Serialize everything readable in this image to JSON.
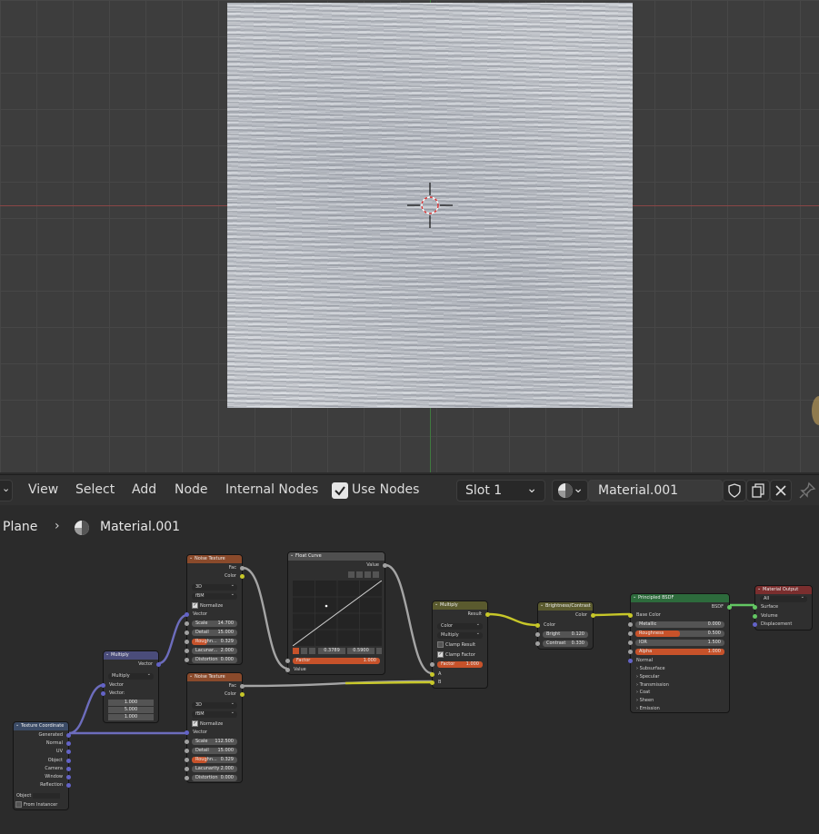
{
  "header": {
    "menu": [
      "View",
      "Select",
      "Add",
      "Node",
      "Internal Nodes"
    ],
    "use_nodes_label": "Use Nodes",
    "slot": "Slot 1",
    "material": "Material.001"
  },
  "breadcrumb": {
    "object": "Plane",
    "material": "Material.001"
  },
  "nodes": {
    "texcoord": {
      "title": "Texture Coordinate",
      "outputs": [
        "Generated",
        "Normal",
        "UV",
        "Object",
        "Camera",
        "Window",
        "Reflection"
      ],
      "object_label": "Object",
      "from_instancer": "From Instancer"
    },
    "vmultiply": {
      "title": "Multiply",
      "out": "Vector",
      "mode": "Multiply",
      "in1": "Vector",
      "in2": "Vector:",
      "v": [
        "1.000",
        "5.000",
        "1.000"
      ]
    },
    "noise1": {
      "title": "Noise Texture",
      "outs": [
        "Fac",
        "Color"
      ],
      "dim": "3D",
      "type": "fBM",
      "normalize": "Normalize",
      "vector": "Vector",
      "fields": [
        [
          "Scale",
          "14.700"
        ],
        [
          "Detail",
          "15.000"
        ],
        [
          "Roughn...",
          "0.329"
        ],
        [
          "Lacunar...",
          "2.000"
        ],
        [
          "Distortion",
          "0.000"
        ]
      ]
    },
    "noise2": {
      "title": "Noise Texture",
      "outs": [
        "Fac",
        "Color"
      ],
      "dim": "3D",
      "type": "fBM",
      "normalize": "Normalize",
      "vector": "Vector",
      "fields": [
        [
          "Scale",
          "112.500"
        ],
        [
          "Detail",
          "15.000"
        ],
        [
          "Roughn...",
          "0.329"
        ],
        [
          "Lacunarity",
          "2.000"
        ],
        [
          "Distortion",
          "0.000"
        ]
      ]
    },
    "curve": {
      "title": "Float Curve",
      "out": "Value",
      "coord_x": "0.3789",
      "coord_y": "0.5900",
      "factor_label": "Factor",
      "factor": "1.000",
      "value_in": "Value"
    },
    "cmultiply": {
      "title": "Multiply",
      "out": "Result",
      "data_type": "Color",
      "mode": "Multiply",
      "clamp_result": "Clamp Result",
      "clamp_factor": "Clamp Factor",
      "factor_label": "Factor",
      "factor": "1.000",
      "a": "A",
      "b": "B"
    },
    "bc": {
      "title": "Brightness/Contrast",
      "out": "Color",
      "in": "Color",
      "bright_label": "Bright",
      "bright": "0.120",
      "contrast_label": "Contrast",
      "contrast": "0.330"
    },
    "bsdf": {
      "title": "Principled BSDF",
      "out": "BSDF",
      "base": "Base Color",
      "fields": [
        [
          "Metallic",
          "0.000"
        ],
        [
          "Roughness",
          "0.500"
        ],
        [
          "IOR",
          "1.500"
        ],
        [
          "Alpha",
          "1.000"
        ]
      ],
      "normal": "Normal",
      "sections": [
        "Subsurface",
        "Specular",
        "Transmission",
        "Coat",
        "Sheen",
        "Emission"
      ]
    },
    "output": {
      "title": "Material Output",
      "target": "All",
      "inputs": [
        "Surface",
        "Volume",
        "Displacement"
      ]
    }
  },
  "colors": {
    "accent_orange": "#c7522a",
    "shader_green": "#2d6b3c",
    "texture_orange": "#8a4a2b",
    "vector_purple": "#4a4c7a",
    "input_red": "#7a2e2e",
    "color_olive": "#5a5a2e",
    "blue_gray": "#3b4b66"
  }
}
